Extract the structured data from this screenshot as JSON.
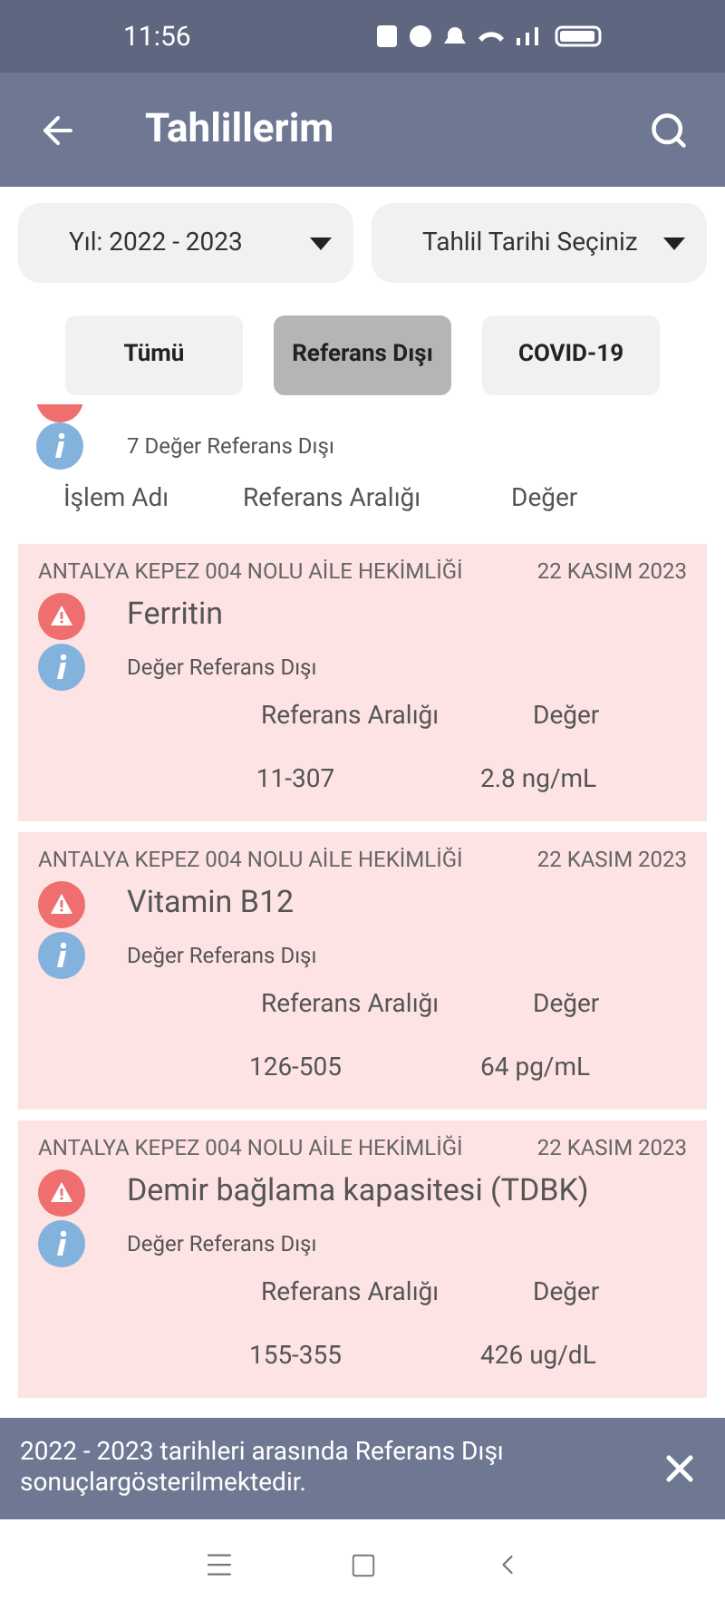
{
  "status_bar": {
    "time": "11:56"
  },
  "app_bar": {
    "title": "Tahlillerim"
  },
  "filters": [
    {
      "value": "Yıl: 2022 - 2023"
    },
    {
      "value": "Tahlil Tarihi Seçiniz"
    }
  ],
  "tabs": [
    {
      "label": "Tümü",
      "selected": false
    },
    {
      "label": "Referans Dışı",
      "selected": true
    },
    {
      "label": "COVID-19",
      "selected": false
    }
  ],
  "partial_group": {
    "summary": "7 Değer Referans Dışı",
    "columns": [
      "İşlem Adı",
      "Referans Aralığı",
      "Değer"
    ]
  },
  "results": [
    {
      "facility": "ANTALYA KEPEZ 004 NOLU AİLE HEKİMLİĞİ",
      "date": "22 KASIM 2023",
      "name": "Ferritin",
      "status": "Değer Referans Dışı",
      "range_label": "Referans Aralığı",
      "value_label": "Değer",
      "range": "11-307",
      "value": "2.8 ng/mL"
    },
    {
      "facility": "ANTALYA KEPEZ 004 NOLU AİLE HEKİMLİĞİ",
      "date": "22 KASIM 2023",
      "name": "Vitamin B12",
      "status": "Değer Referans Dışı",
      "range_label": "Referans Aralığı",
      "value_label": "Değer",
      "range": "126-505",
      "value": "64 pg/mL"
    },
    {
      "facility": "ANTALYA KEPEZ 004 NOLU AİLE HEKİMLİĞİ",
      "date": "22 KASIM 2023",
      "name": "Demir bağlama kapasitesi (TDBK)",
      "status": "Değer Referans Dışı",
      "range_label": "Referans Aralığı",
      "value_label": "Değer",
      "range": "155-355",
      "value": "426 ug/dL"
    }
  ],
  "snackbar": {
    "message": "2022 - 2023 tarihleri arasında Referans Dışı sonuçlargösterilmektedir."
  }
}
